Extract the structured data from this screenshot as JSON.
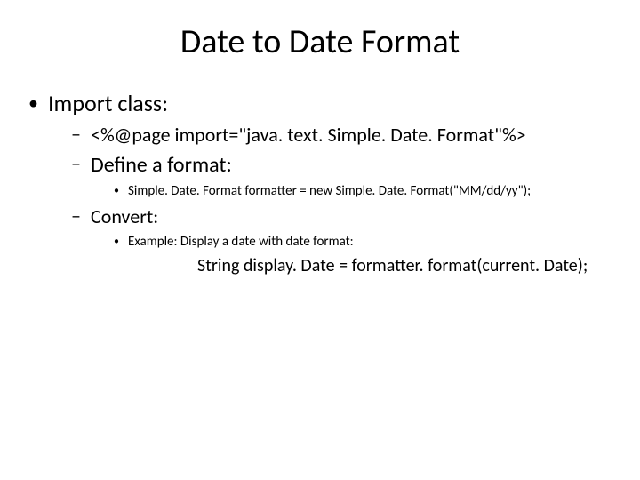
{
  "title": "Date to Date Format",
  "lvl1": {
    "item1": "Import class:"
  },
  "lvl2": {
    "import_directive": "<%@page import=\"java. text. Simple. Date. Format\"%>",
    "define_format": "Define a format:",
    "convert": "Convert:"
  },
  "lvl3": {
    "formatter_line": "Simple. Date. Format formatter = new Simple. Date. Format(\"MM/dd/yy\");",
    "example_label": "Example: Display a date with date format:"
  },
  "code_line": "String display. Date = formatter. format(current. Date);"
}
